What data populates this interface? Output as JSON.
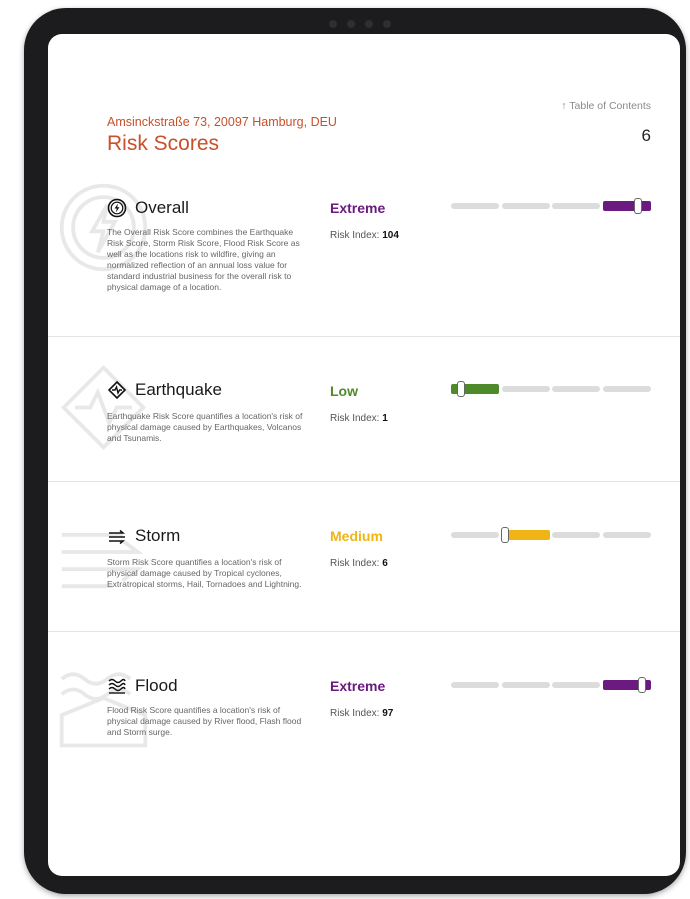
{
  "header": {
    "toc_link": "↑ Table of Contents",
    "page_number": "6",
    "address": "Amsinckstraße 73, 20097 Hamburg, DEU",
    "title": "Risk Scores"
  },
  "colors": {
    "extreme": "#6b1a80",
    "low": "#4f8a2a",
    "medium": "#f0b514",
    "title": "#c8502a"
  },
  "risks": [
    {
      "icon": "lightning-circle-icon",
      "name": "Overall",
      "level": "Extreme",
      "index_label": "Risk Index:",
      "index_value": "104",
      "description": "The Overall Risk Score combines the Earthquake Risk Score, Storm Risk Score, Flood Risk Score as well as the locations risk to wildfire, giving an normalized reflection of an annual loss value for standard industrial business for the overall risk to physical damage of a location.",
      "gauge_level": 0.93
    },
    {
      "icon": "earthquake-icon",
      "name": "Earthquake",
      "level": "Low",
      "index_label": "Risk Index:",
      "index_value": "1",
      "description": "Earthquake Risk Score quantifies a location's risk of physical damage caused by Earthquakes, Volcanos and Tsunamis.",
      "gauge_level": 0.05
    },
    {
      "icon": "storm-wind-icon",
      "name": "Storm",
      "level": "Medium",
      "index_label": "Risk Index:",
      "index_value": "6",
      "description": "Storm Risk Score quantifies a location's risk of physical damage caused by Tropical cyclones, Extratropical storms, Hail, Tornadoes and Lightning.",
      "gauge_level": 0.27
    },
    {
      "icon": "flood-waves-icon",
      "name": "Flood",
      "level": "Extreme",
      "index_label": "Risk Index:",
      "index_value": "97",
      "description": "Flood Risk Score quantifies a location's risk of physical damage caused by River flood, Flash flood and Storm surge.",
      "gauge_level": 0.95
    }
  ]
}
